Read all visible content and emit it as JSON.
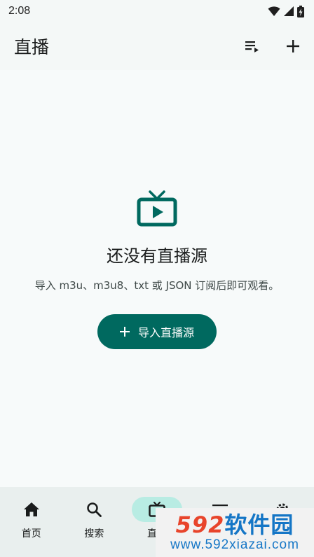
{
  "status": {
    "time": "2:08",
    "icons": [
      "wifi-icon",
      "signal-icon",
      "battery-charging-icon"
    ]
  },
  "app_bar": {
    "title": "直播",
    "actions": [
      "playlist-icon",
      "add-icon"
    ]
  },
  "empty_state": {
    "icon": "live-tv-icon",
    "title": "还没有直播源",
    "description": "导入 m3u、m3u8、txt 或 JSON 订阅后即可观看。",
    "button_label": "导入直播源",
    "button_icon": "add-icon"
  },
  "nav": {
    "items": [
      {
        "label": "首页",
        "icon": "home-icon",
        "active": false
      },
      {
        "label": "搜索",
        "icon": "search-icon",
        "active": false
      },
      {
        "label": "直播",
        "icon": "live-tv-icon",
        "active": true
      },
      {
        "label": "",
        "icon": "list-icon",
        "active": false
      },
      {
        "label": "",
        "icon": "settings-icon",
        "active": false
      }
    ]
  },
  "watermark": {
    "number": "592",
    "brand": "软件园",
    "url": "www.592xiazai.com"
  },
  "colors": {
    "accent": "#00695f",
    "active_pill": "#b8ece3",
    "background": "#f7fafa",
    "nav_background": "#e9efee"
  }
}
